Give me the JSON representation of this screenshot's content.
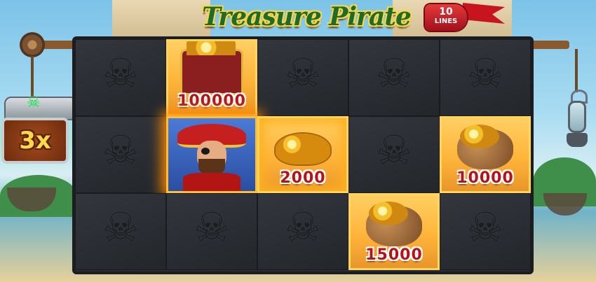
{
  "game": {
    "title": "Treasure Pirate",
    "lines_count": "10",
    "lines_label": "LINES"
  },
  "multiplier": {
    "label": "3x"
  },
  "reels": {
    "rows": 3,
    "columns": 5,
    "cells": [
      [
        {
          "symbol": "skull-flag-icon",
          "value": null
        },
        {
          "symbol": "treasure-chest-icon",
          "value": "100000"
        },
        {
          "symbol": "skull-flag-icon",
          "value": null
        },
        {
          "symbol": "skull-flag-icon",
          "value": null
        },
        {
          "symbol": "skull-flag-icon",
          "value": null
        }
      ],
      [
        {
          "symbol": "skull-flag-icon",
          "value": null
        },
        {
          "symbol": "pirate-captain-icon",
          "value": null
        },
        {
          "symbol": "gold-coins-icon",
          "value": "2000"
        },
        {
          "symbol": "skull-flag-icon",
          "value": null
        },
        {
          "symbol": "coin-bag-icon",
          "value": "10000"
        }
      ],
      [
        {
          "symbol": "skull-flag-icon",
          "value": null
        },
        {
          "symbol": "skull-flag-icon",
          "value": null
        },
        {
          "symbol": "skull-flag-icon",
          "value": null
        },
        {
          "symbol": "coin-bag-icon",
          "value": "15000"
        },
        {
          "symbol": "skull-flag-icon",
          "value": null
        }
      ]
    ]
  },
  "colors": {
    "value_text": "#b3131b",
    "treasure_bg": "#ffb43a",
    "empty_cell": "#2a2d33",
    "multiplier_text": "#ffd74a",
    "title_text": "#1f6b2a"
  }
}
